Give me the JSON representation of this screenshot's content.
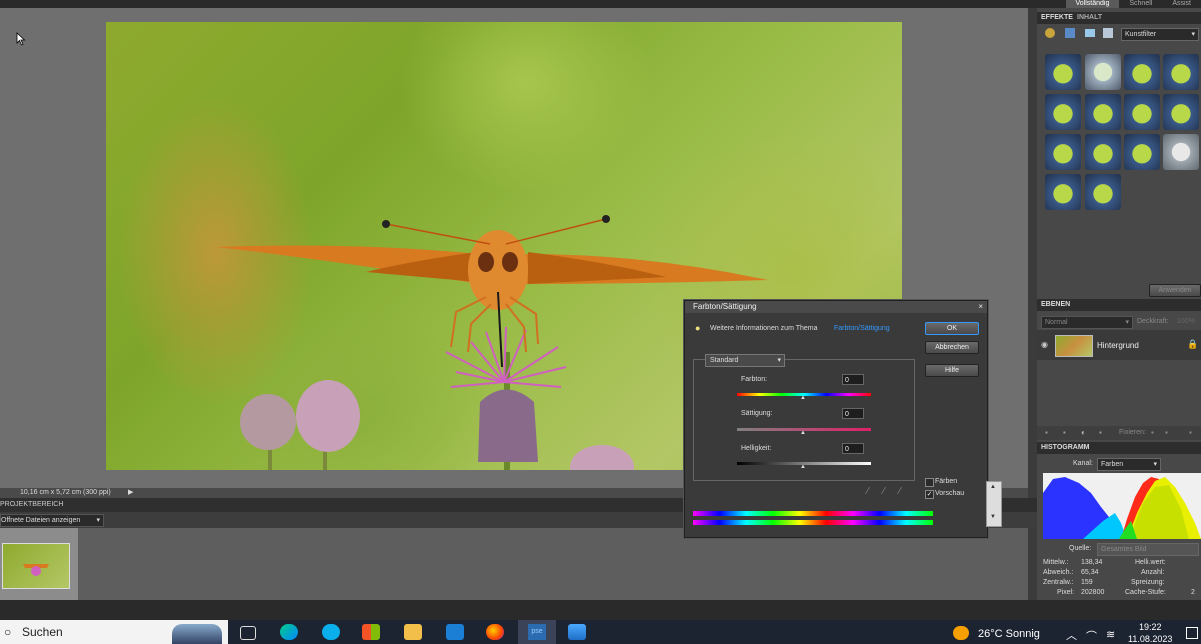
{
  "top_tabs": [
    "Vollständig",
    "Schnell",
    "Assist"
  ],
  "status": {
    "dimensions": "10,16 cm x 5,72 cm (300 ppi)"
  },
  "project_bin": {
    "title": "PROJEKTBEREICH",
    "dropdown": "Offnete Dateien anzeigen"
  },
  "panels": {
    "effects_tabs": [
      "EFFEKTE",
      "INHALT"
    ],
    "filter_dropdown": "Kunstfilter",
    "apply_button": "Anwenden",
    "layers_title": "EBENEN",
    "blend_mode": "Normal",
    "opacity_label": "Deckkraft:",
    "opacity_value": "100%",
    "layer_name": "Hintergrund",
    "lock_label": "Fixieren:",
    "histogram_title": "HISTOGRAMM",
    "channel_label": "Kanal:",
    "channel_value": "Farben",
    "source_label": "Quelle:",
    "source_value": "Gesamtes Bild",
    "stats": {
      "mean_label": "Mittelw.:",
      "mean": "138,34",
      "dev_label": "Abweich.:",
      "dev": "65,34",
      "median_label": "Zentralw.:",
      "median": "159",
      "pixels_label": "Pixel:",
      "pixels": "202800",
      "level_label": "Helli.wert:",
      "count_label": "Anzahl:",
      "percentile_label": "Spreizung:",
      "cache_label": "Cache-Stufe:",
      "cache": "2"
    }
  },
  "dialog": {
    "title": "Farbton/Sättigung",
    "info_text": "Weitere Informationen zum Thema",
    "info_link": "Farbton/Sättigung",
    "ok": "OK",
    "cancel": "Abbrechen",
    "help": "Hilfe",
    "edit_dropdown": "Standard",
    "hue_label": "Farbton:",
    "hue_value": "0",
    "saturation_label": "Sättigung:",
    "saturation_value": "0",
    "lightness_label": "Helligkeit:",
    "lightness_value": "0",
    "colorize_label": "Färben",
    "colorize_checked": false,
    "preview_label": "Vorschau",
    "preview_checked": true
  },
  "taskbar": {
    "search": "Suchen",
    "weather": "26°C Sonnig",
    "time": "19:22",
    "date": "11.08.2023"
  },
  "colors": {
    "accent": "#3399ff",
    "panel_bg": "#484848",
    "workspace_bg": "#6f6f6f"
  }
}
